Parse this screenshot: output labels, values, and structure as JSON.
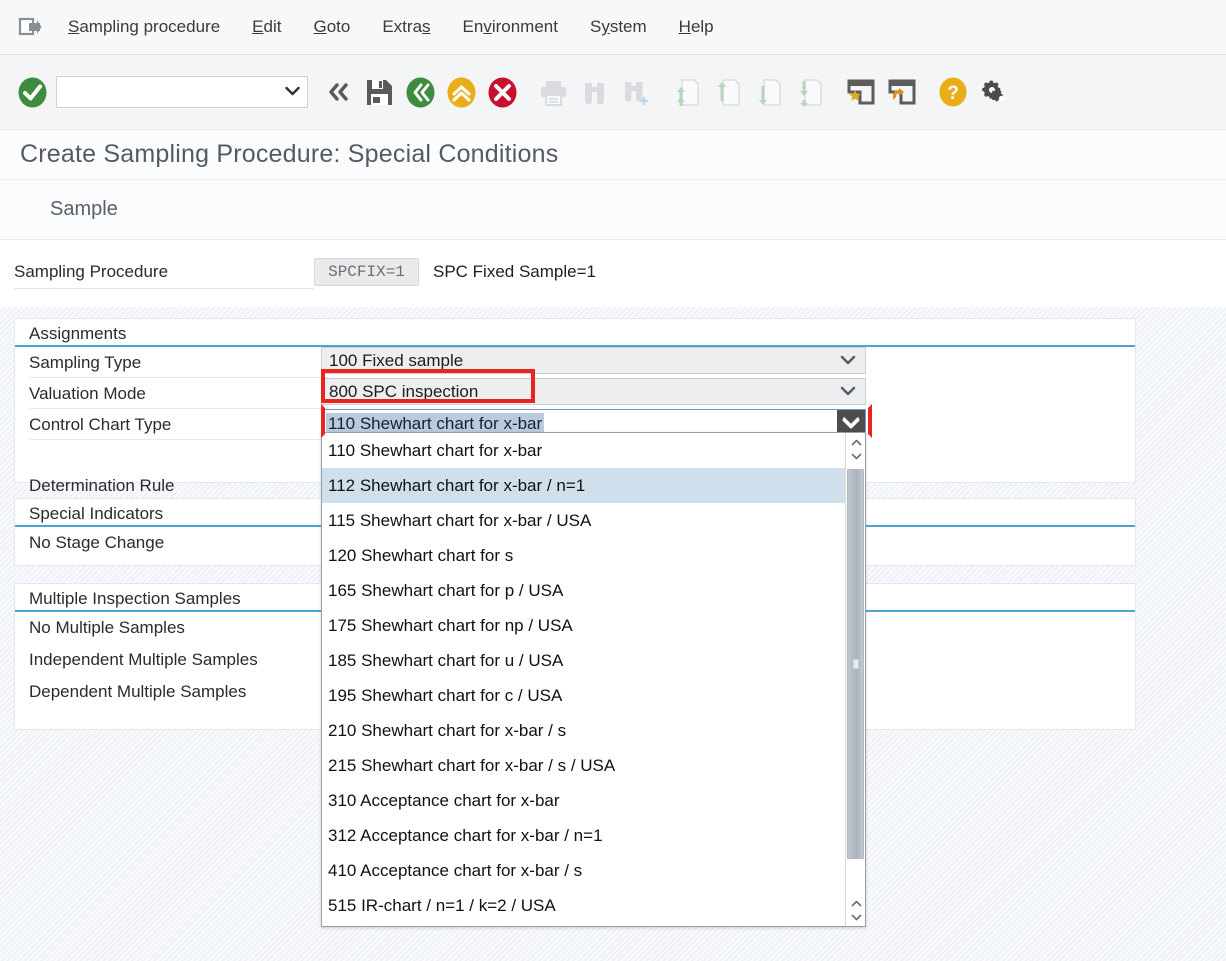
{
  "menu": {
    "app_icon": "document-arrow-icon",
    "items": [
      {
        "label": "Sampling procedure",
        "accel_index": 1
      },
      {
        "label": "Edit",
        "accel_index": 0
      },
      {
        "label": "Goto",
        "accel_index": 0
      },
      {
        "label": "Extras",
        "accel_index": 4
      },
      {
        "label": "Environment",
        "accel_index": 2
      },
      {
        "label": "System",
        "accel_index": 1
      },
      {
        "label": "Help",
        "accel_index": 0
      }
    ]
  },
  "toolbar": {
    "ok_icon": "green-check-enter-icon",
    "command_value": "",
    "command_placeholder": "",
    "command_dropdown_icon": "chevron-down-icon",
    "buttons": [
      {
        "name": "back-history-icon",
        "glyph": "«",
        "enabled": true
      },
      {
        "name": "save-icon",
        "glyph": "floppy",
        "enabled": true
      },
      {
        "name": "back-green-icon",
        "glyph": "«",
        "enabled": true
      },
      {
        "name": "exit-yellow-icon",
        "glyph": "^",
        "enabled": true
      },
      {
        "name": "cancel-red-icon",
        "glyph": "x",
        "enabled": true
      },
      {
        "name": "print-icon",
        "glyph": "printer",
        "enabled": false
      },
      {
        "name": "find-icon",
        "glyph": "binoculars",
        "enabled": false
      },
      {
        "name": "find-next-icon",
        "glyph": "binoculars-plus",
        "enabled": false
      },
      {
        "name": "first-page-icon",
        "glyph": "page-up-top",
        "enabled": false
      },
      {
        "name": "previous-page-icon",
        "glyph": "page-up",
        "enabled": false
      },
      {
        "name": "next-page-icon",
        "glyph": "page-down",
        "enabled": false
      },
      {
        "name": "last-page-icon",
        "glyph": "page-down-bottom",
        "enabled": false
      },
      {
        "name": "create-session-icon",
        "glyph": "window-star",
        "enabled": true
      },
      {
        "name": "create-shortcut-icon",
        "glyph": "window-arrow",
        "enabled": true
      },
      {
        "name": "help-icon",
        "glyph": "question",
        "enabled": true
      },
      {
        "name": "customize-local-layout-icon",
        "glyph": "gears",
        "enabled": true
      }
    ]
  },
  "page": {
    "title": "Create Sampling Procedure: Special Conditions",
    "tab_label": "Sample"
  },
  "header_field": {
    "label": "Sampling Procedure",
    "value": "SPCFIX=1",
    "description": "SPC Fixed Sample=1"
  },
  "sections": {
    "assignments": {
      "title": "Assignments",
      "rows": [
        {
          "label": "Sampling Type",
          "value": "100 Fixed sample"
        },
        {
          "label": "Valuation Mode",
          "value": "800 SPC inspection"
        },
        {
          "label": "Control Chart Type",
          "value": "110 Shewhart chart for x-bar"
        },
        {
          "label": "Determination Rule",
          "value": ""
        }
      ]
    },
    "special_indicators": {
      "title": "Special Indicators",
      "rows": [
        {
          "label": "No Stage Change"
        }
      ]
    },
    "multiple_inspection_samples": {
      "title": "Multiple Inspection Samples",
      "rows": [
        {
          "label": "No Multiple Samples"
        },
        {
          "label": "Independent Multiple Samples"
        },
        {
          "label": "Dependent Multiple Samples"
        }
      ]
    }
  },
  "dropdown": {
    "open": true,
    "selected": "110 Shewhart chart for x-bar",
    "highlighted": "112 Shewhart chart for x-bar / n=1",
    "options": [
      "110 Shewhart chart for x-bar",
      "112 Shewhart chart for x-bar / n=1",
      "115 Shewhart chart for x-bar / USA",
      "120 Shewhart chart for s",
      "165 Shewhart chart for p / USA",
      "175 Shewhart chart for np / USA",
      "185 Shewhart chart for u / USA",
      "195 Shewhart chart for c / USA",
      "210 Shewhart chart for x-bar / s",
      "215 Shewhart chart for x-bar / s / USA",
      "310 Acceptance chart for x-bar",
      "312 Acceptance chart for x-bar / n=1",
      "410 Acceptance chart for x-bar / s",
      "515 IR-chart / n=1 / k=2 / USA"
    ],
    "scrollbar": {
      "up_icon": "chevron-up-icon",
      "down_icon": "chevron-down-icon"
    }
  },
  "annotations": {
    "highlight_color": "#e8251e",
    "boxes": [
      {
        "name": "valuation-mode-highlight",
        "target": "800 SPC inspection"
      },
      {
        "name": "control-chart-type-highlight",
        "target": "110 Shewhart chart for x-bar"
      }
    ]
  },
  "colors": {
    "accent_blue": "#4ba3d8",
    "selection_blue": "#b9cbdd",
    "hover_blue": "#cfdfeb",
    "canvas": "#eef2f7",
    "toolbar": "#f4f5f7"
  }
}
